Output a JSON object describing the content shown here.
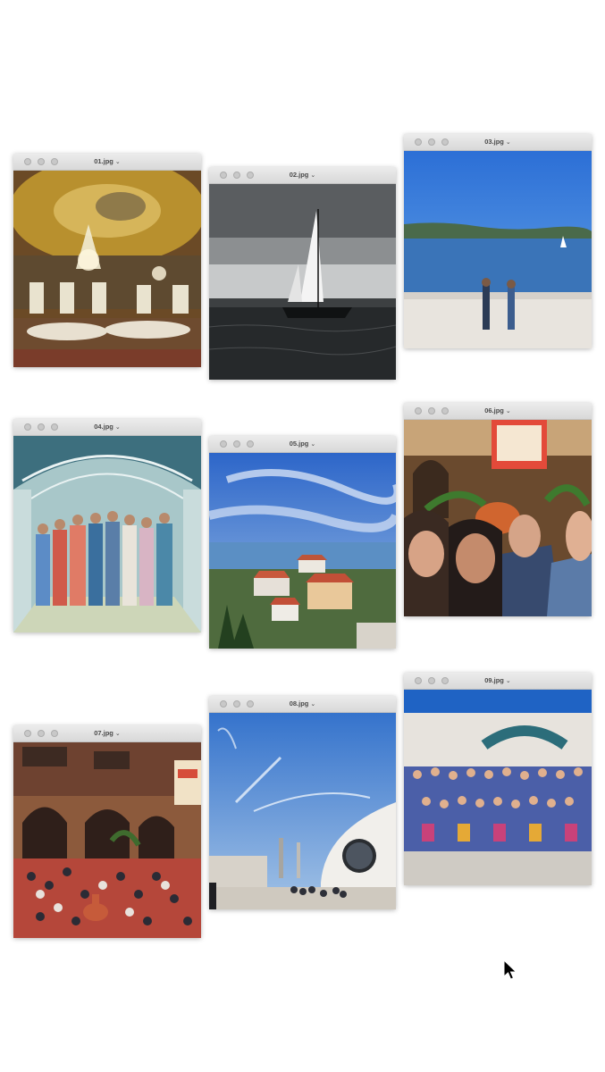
{
  "windows": [
    {
      "title": "01.jpg",
      "menu_icon": "chevron-down-icon",
      "scene": "ornate ballroom with chandeliers"
    },
    {
      "title": "02.jpg",
      "menu_icon": "chevron-down-icon",
      "scene": "sailboat on dark water"
    },
    {
      "title": "03.jpg",
      "menu_icon": "chevron-down-icon",
      "scene": "two people at waterfront"
    },
    {
      "title": "04.jpg",
      "menu_icon": "chevron-down-icon",
      "scene": "group photo in glass tunnel"
    },
    {
      "title": "05.jpg",
      "menu_icon": "chevron-down-icon",
      "scene": "coastal town with red roofs"
    },
    {
      "title": "06.jpg",
      "menu_icon": "chevron-down-icon",
      "scene": "smiling selfie in courtyard"
    },
    {
      "title": "07.jpg",
      "menu_icon": "chevron-down-icon",
      "scene": "crowded courtyard with fountain"
    },
    {
      "title": "08.jpg",
      "menu_icon": "chevron-down-icon",
      "scene": "blue sky and modern white building"
    },
    {
      "title": "09.jpg",
      "menu_icon": "chevron-down-icon",
      "scene": "large group photo in front of building"
    }
  ],
  "chevron": "⌄",
  "colors": {
    "titlebar": "#e2e2e2",
    "title_text": "#4a4a4a",
    "background": "#ffffff"
  }
}
